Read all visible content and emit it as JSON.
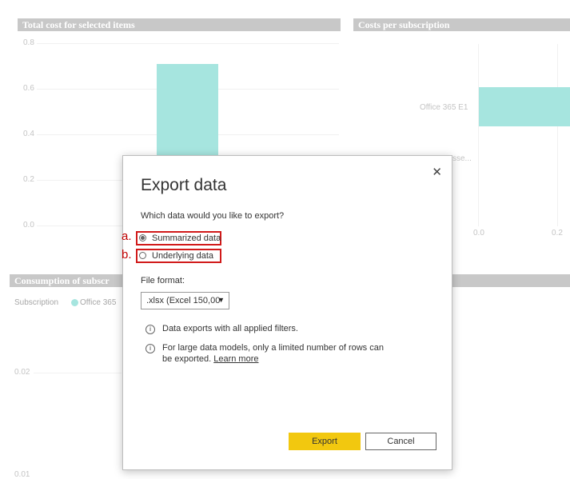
{
  "panels": {
    "total_cost": {
      "title": "Total cost for selected items",
      "y_ticks": [
        "0.8",
        "0.6",
        "0.4",
        "0.2",
        "0.0"
      ]
    },
    "costs_per_subscription": {
      "title": "Costs per subscription",
      "category_label": "Office 365 E1",
      "truncated_label": "sse...",
      "x_ticks": [
        "0.0",
        "0.2"
      ]
    },
    "consumption": {
      "title": "Consumption of subscr",
      "legend_title": "Subscription",
      "legend_item": "Office 365",
      "y_ticks": [
        "0.02",
        "0.01"
      ]
    }
  },
  "chart_data": [
    {
      "type": "bar",
      "title": "Total cost for selected items",
      "values": [
        0.71
      ],
      "ylim": [
        0,
        0.8
      ],
      "color": "#a6e5df"
    },
    {
      "type": "bar",
      "title": "Costs per subscription",
      "categories": [
        "Office 365 E1"
      ],
      "color": "#a6e5df"
    }
  ],
  "dialog": {
    "title": "Export data",
    "question": "Which data would you like to export?",
    "options": [
      {
        "marker": "a.",
        "label": "Summarized data",
        "selected": true
      },
      {
        "marker": "b.",
        "label": "Underlying data",
        "selected": false
      }
    ],
    "file_format_label": "File format:",
    "file_format_value": ".xlsx (Excel 150,00",
    "info": [
      {
        "text": "Data exports with all applied filters."
      },
      {
        "text": "For large data models, only a limited number of rows can be exported.",
        "link": "Learn more"
      }
    ],
    "export_label": "Export",
    "cancel_label": "Cancel",
    "close_glyph": "✕",
    "info_glyph": "i"
  },
  "colors": {
    "accent": "#f2c80f",
    "bar": "#a6e5df",
    "highlight": "#d11a1a",
    "marker": "#c00000",
    "panel_header": "#c8c8c8"
  }
}
